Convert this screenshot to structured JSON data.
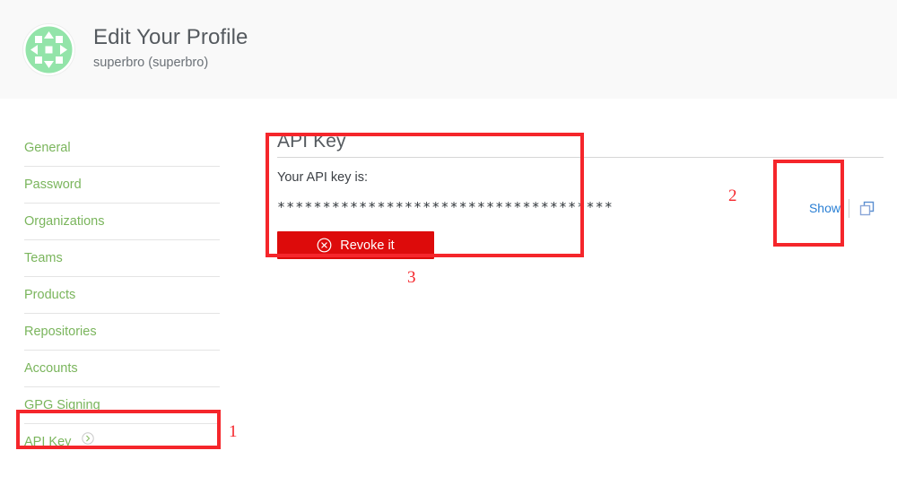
{
  "header": {
    "title": "Edit Your Profile",
    "subtitle": "superbro (superbro)",
    "avatar_icon": "identicon-avatar",
    "avatar_color": "#93e4a9",
    "background": "#f9f9f9"
  },
  "sidebar": {
    "items": [
      {
        "label": "General",
        "icon": null
      },
      {
        "label": "Password",
        "icon": null
      },
      {
        "label": "Organizations",
        "icon": null
      },
      {
        "label": "Teams",
        "icon": null
      },
      {
        "label": "Products",
        "icon": null
      },
      {
        "label": "Repositories",
        "icon": null
      },
      {
        "label": "Accounts",
        "icon": null
      },
      {
        "label": "GPG Signing",
        "icon": null
      },
      {
        "label": "API Key",
        "icon": "chevron-right-circle-icon"
      }
    ],
    "link_color": "#7ab55c"
  },
  "main": {
    "title": "API Key",
    "field_label": "Your API key is:",
    "api_key_masked": "*************************************",
    "show_link": "Show",
    "copy_icon": "copy-icon",
    "revoke_button": {
      "label": "Revoke it",
      "icon": "circle-x-icon",
      "color": "#dd0b0b"
    }
  },
  "annotations": {
    "color": "#f5262b",
    "markers": [
      {
        "number": "1",
        "target": "sidebar-item-api-key"
      },
      {
        "number": "2",
        "target": "show-link"
      },
      {
        "number": "3",
        "target": "api-key-panel"
      }
    ]
  }
}
